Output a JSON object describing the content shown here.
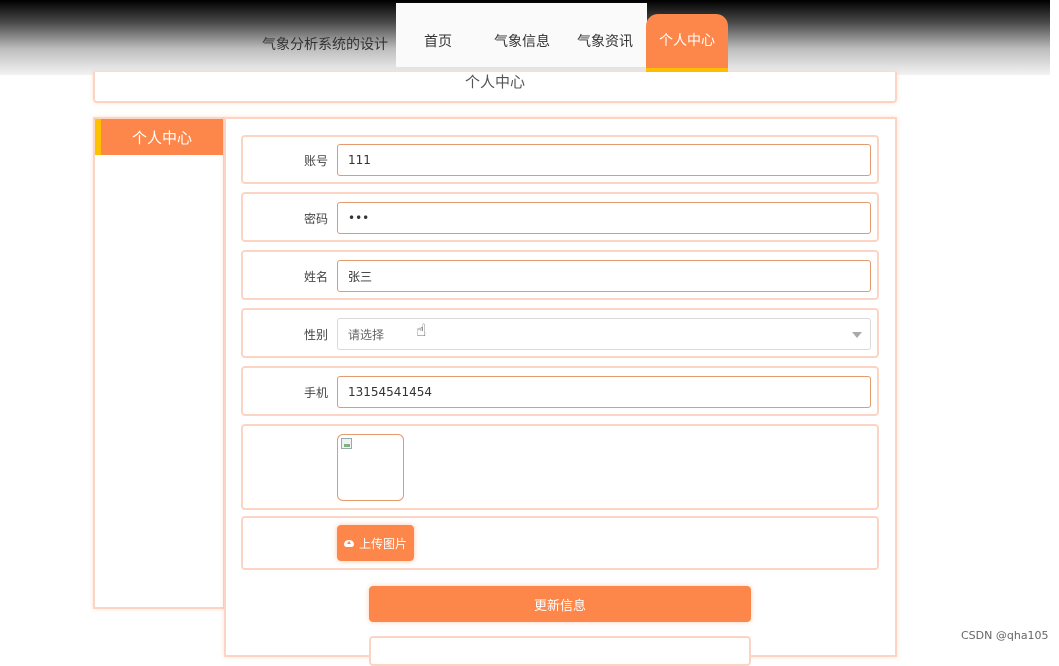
{
  "header": {
    "brand": "气象分析系统的设计",
    "nav": [
      {
        "label": "首页"
      },
      {
        "label": "气象信息"
      },
      {
        "label": "气象资讯"
      },
      {
        "label": "个人中心"
      }
    ]
  },
  "page_title": "个人中心",
  "sidebar": {
    "items": [
      {
        "label": "个人中心"
      }
    ]
  },
  "form": {
    "account": {
      "label": "账号",
      "value": "111"
    },
    "password": {
      "label": "密码",
      "value": "•••"
    },
    "name": {
      "label": "姓名",
      "value": "张三"
    },
    "gender": {
      "label": "性别",
      "value": "请选择"
    },
    "phone": {
      "label": "手机",
      "value": "13154541454"
    },
    "upload_label": "上传图片",
    "update_label": "更新信息"
  },
  "watermark": "CSDN @qha105",
  "colors": {
    "accent": "#fd874a",
    "accent_edge": "#ffc000",
    "border": "#fcd4c4"
  },
  "icons": [
    "hand-pointer-icon",
    "broken-image-icon",
    "cloud-upload-icon",
    "chevron-down-icon"
  ]
}
